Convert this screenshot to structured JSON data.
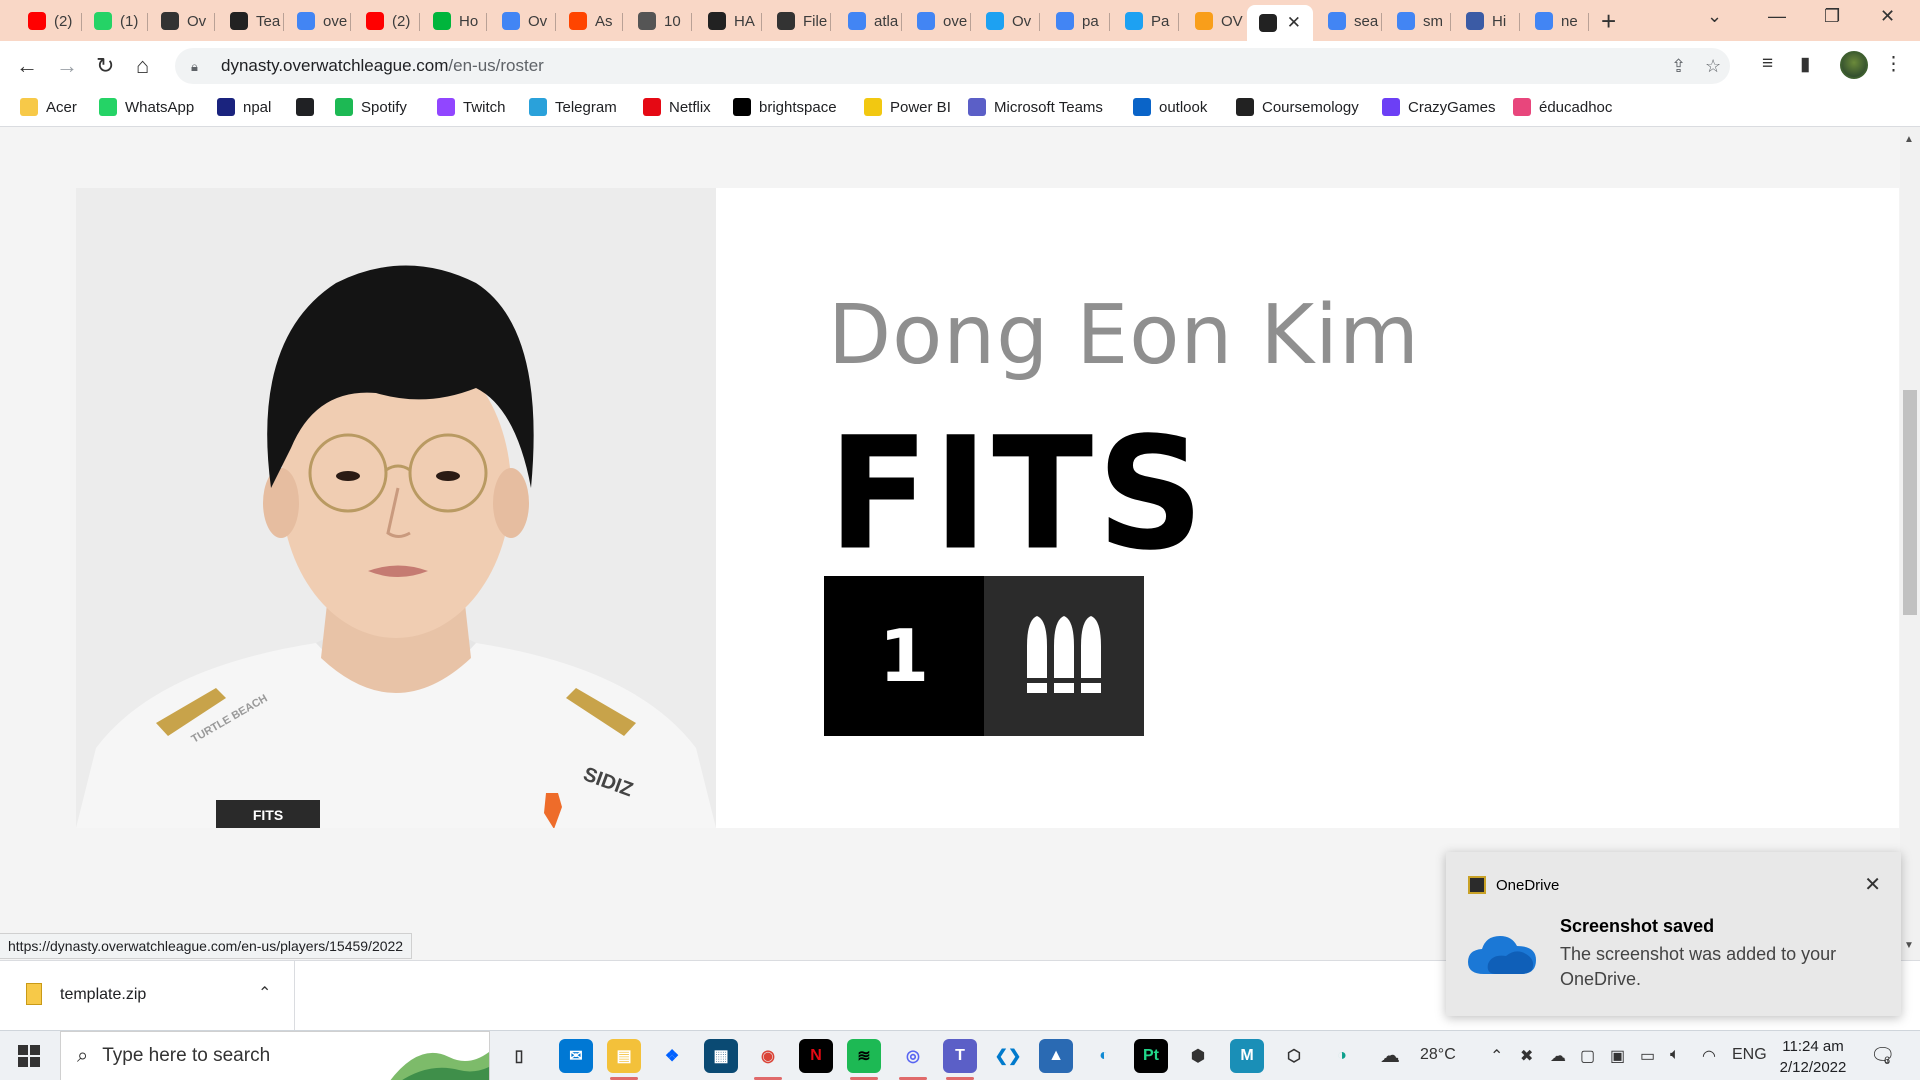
{
  "browser": {
    "tabs": [
      {
        "label": "(2)",
        "icon": "youtube-icon",
        "color": "#ff0000"
      },
      {
        "label": "(1)",
        "icon": "whatsapp-icon",
        "color": "#25d366"
      },
      {
        "label": "Ov",
        "icon": "overwatch-icon",
        "color": "#333333"
      },
      {
        "label": "Tea",
        "icon": "dynasty-flag-icon",
        "color": "#222222"
      },
      {
        "label": "ove",
        "icon": "google-icon",
        "color": "#4285f4"
      },
      {
        "label": "(2)",
        "icon": "youtube-icon",
        "color": "#ff0000"
      },
      {
        "label": "Ho",
        "icon": "webtoon-icon",
        "color": "#00b53c"
      },
      {
        "label": "Ov",
        "icon": "google-icon",
        "color": "#4285f4"
      },
      {
        "label": "As",
        "icon": "reddit-icon",
        "color": "#ff4500"
      },
      {
        "label": "10",
        "icon": "globe-icon",
        "color": "#555555"
      },
      {
        "label": "HA",
        "icon": "dynasty-flag-icon",
        "color": "#222222"
      },
      {
        "label": "File",
        "icon": "fandom-icon",
        "color": "#333333"
      },
      {
        "label": "atla",
        "icon": "google-icon",
        "color": "#4285f4"
      },
      {
        "label": "ove",
        "icon": "google-icon",
        "color": "#4285f4"
      },
      {
        "label": "Ov",
        "icon": "twitter-icon",
        "color": "#1da1f2"
      },
      {
        "label": "pa",
        "icon": "google-icon",
        "color": "#4285f4"
      },
      {
        "label": "Pa",
        "icon": "twitter-icon",
        "color": "#1da1f2"
      },
      {
        "label": "OV",
        "icon": "owl-icon",
        "color": "#f99e1a"
      },
      {
        "label": "",
        "icon": "dynasty-flag-icon",
        "color": "#222222",
        "active": true
      },
      {
        "label": "sea",
        "icon": "google-icon",
        "color": "#4285f4"
      },
      {
        "label": "sm",
        "icon": "google-icon",
        "color": "#4285f4"
      },
      {
        "label": "Hi",
        "icon": "planet-icon",
        "color": "#3b5ba5"
      },
      {
        "label": "ne",
        "icon": "google-icon",
        "color": "#4285f4"
      }
    ],
    "url_host": "dynasty.overwatchleague.com",
    "url_path": "/en-us/roster",
    "bookmarks": [
      {
        "label": "Acer",
        "icon": "folder-icon",
        "color": "#f7c948"
      },
      {
        "label": "WhatsApp",
        "icon": "whatsapp-icon",
        "color": "#25d366"
      },
      {
        "label": "npal",
        "icon": "npal-icon",
        "color": "#1a237e"
      },
      {
        "label": "",
        "icon": "globe-icon",
        "color": "#202124"
      },
      {
        "label": "Spotify",
        "icon": "spotify-icon",
        "color": "#1db954"
      },
      {
        "label": "Twitch",
        "icon": "twitch-icon",
        "color": "#9146ff"
      },
      {
        "label": "Telegram",
        "icon": "telegram-icon",
        "color": "#2aa1da"
      },
      {
        "label": "Netflix",
        "icon": "netflix-icon",
        "color": "#e50914"
      },
      {
        "label": "brightspace",
        "icon": "np-icon",
        "color": "#000000"
      },
      {
        "label": "Power BI",
        "icon": "powerbi-icon",
        "color": "#f2c811"
      },
      {
        "label": "Microsoft Teams",
        "icon": "teams-icon",
        "color": "#5b5fc7"
      },
      {
        "label": "outlook",
        "icon": "outlook-icon",
        "color": "#0a64c8"
      },
      {
        "label": "Coursemology",
        "icon": "coursemology-icon",
        "color": "#222222"
      },
      {
        "label": "CrazyGames",
        "icon": "crazygames-icon",
        "color": "#6c3ff5"
      },
      {
        "label": "éducadhoc",
        "icon": "educadhoc-icon",
        "color": "#e8467c"
      }
    ]
  },
  "player": {
    "real_name": "Dong Eon Kim",
    "handle": "FITS",
    "number": "1",
    "role_icon": "damage-role-icon",
    "photo_jersey_text": "FITS",
    "photo_sponsor_1": "TURTLE BEACH",
    "photo_sponsor_2": "SIDIZ"
  },
  "status_url": "https://dynasty.overwatchleague.com/en-us/players/15459/2022",
  "toast": {
    "app": "OneDrive",
    "title": "Screenshot saved",
    "body": "The screenshot was added to your OneDrive."
  },
  "downloads": {
    "file": "template.zip"
  },
  "taskbar": {
    "search_placeholder": "Type here to search",
    "weather": "28°C",
    "language": "ENG",
    "time": "11:24 am",
    "date": "2/12/2022",
    "notifications": "6"
  }
}
